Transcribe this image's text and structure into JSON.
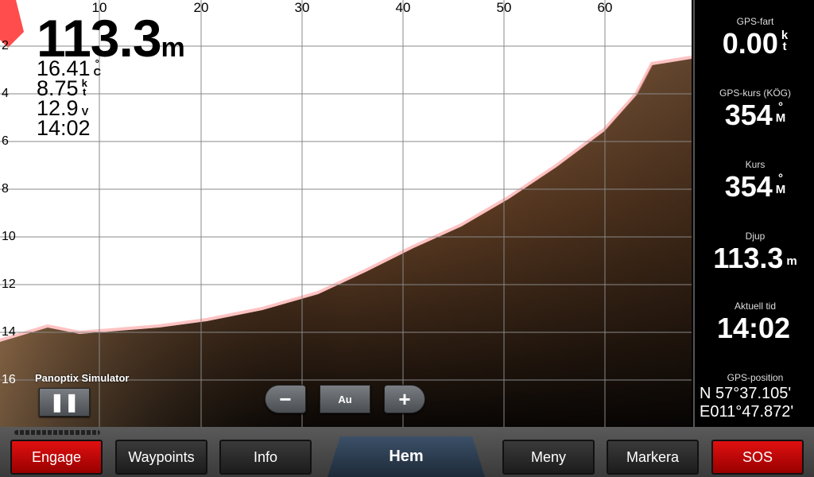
{
  "sonar": {
    "x_labels": [
      "10",
      "20",
      "30",
      "40",
      "50",
      "60"
    ],
    "y_labels": [
      "2",
      "4",
      "6",
      "8",
      "10",
      "12",
      "14",
      "16"
    ],
    "depth": {
      "value": "113.3",
      "unit": "m"
    },
    "readouts": [
      {
        "value": "16.41",
        "unit_top": "°",
        "unit_bottom": "C"
      },
      {
        "value": "8.75",
        "unit_top": "k",
        "unit_bottom": "t"
      },
      {
        "value": "12.9",
        "unit_top": "",
        "unit_bottom": "V"
      },
      {
        "value": "14:02",
        "unit_top": "",
        "unit_bottom": ""
      }
    ],
    "simulator_label": "Panoptix Simulator",
    "pause_icon": "pause-icon",
    "zoom_out": "−",
    "zoom_auto": "Au",
    "zoom_in": "+",
    "colors": {
      "bottom": "#8a5a35",
      "echo": "#ff3030"
    }
  },
  "panel": [
    {
      "label": "GPS-fart",
      "value": "0.00",
      "unit_top": "k",
      "unit_bottom": "t"
    },
    {
      "label": "GPS-kurs (KÖG)",
      "value": "354",
      "unit_top": "°",
      "unit_bottom": "M"
    },
    {
      "label": "Kurs",
      "value": "354",
      "unit_top": "°",
      "unit_bottom": "M"
    },
    {
      "label": "Djup",
      "value": "113.3",
      "unit_top": "",
      "unit_bottom": "m"
    },
    {
      "label": "Aktuell tid",
      "value": "14:02",
      "unit_top": "",
      "unit_bottom": ""
    },
    {
      "label": "GPS-position",
      "lat": "N  57°37.105'",
      "lon": "E011°47.872'"
    }
  ],
  "softkeys": {
    "engage": "Engage",
    "waypoints": "Waypoints",
    "info": "Info",
    "home": "Hem",
    "menu": "Meny",
    "mark": "Markera",
    "sos": "SOS"
  },
  "colors": {
    "red_key": "#d01010",
    "home": "#2c3e52"
  }
}
